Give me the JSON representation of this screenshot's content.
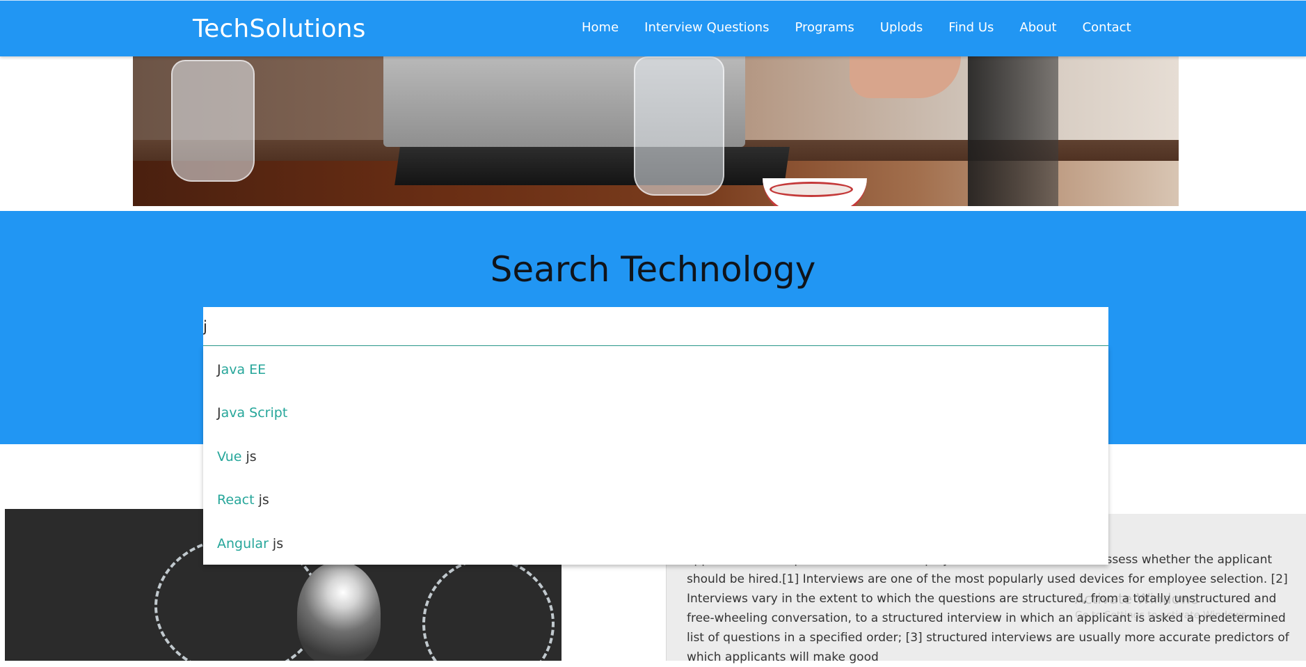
{
  "navbar": {
    "brand": "TechSolutions",
    "links": [
      "Home",
      "Interview Questions",
      "Programs",
      "Uplods",
      "Find Us",
      "About",
      "Contact"
    ]
  },
  "search": {
    "title": "Search Technology",
    "value": "j",
    "suggestions": [
      {
        "before": "",
        "match": "J",
        "after": "ava EE"
      },
      {
        "before": "",
        "match": "J",
        "after": "ava Script"
      },
      {
        "before": "Vue ",
        "match": "js",
        "after": ""
      },
      {
        "before": "React ",
        "match": "js",
        "after": ""
      },
      {
        "before": "Angular ",
        "match": "js",
        "after": ""
      }
    ]
  },
  "content": {
    "paragraph": "applicant and a representative of an employer which is conducted to assess whether the applicant should be hired.[1] Interviews are one of the most popularly used devices for employee selection. [2] Interviews vary in the extent to which the questions are structured, from a totally unstructured and free-wheeling conversation, to a structured interview in which an applicant is asked a predetermined list of questions in a specified order; [3] structured interviews are usually more accurate predictors of which applicants will make good"
  },
  "watermark": {
    "title": "Activate Windows",
    "subtitle": "Go to Settings to activate Windows."
  }
}
